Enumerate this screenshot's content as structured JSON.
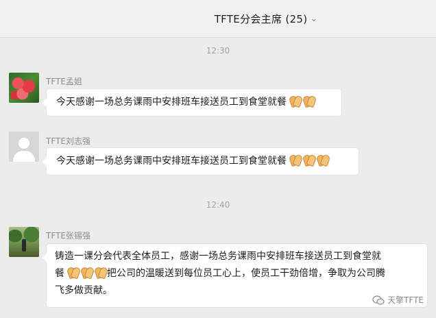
{
  "header": {
    "title": "TFTE分会主席 (25)",
    "chevron_icon": "chevron-down-icon"
  },
  "timestamps": [
    "12:30",
    "12:40"
  ],
  "messages": [
    {
      "sender": "TFTE孟姐",
      "avatar": "flower-photo",
      "text": "今天感谢一场总务课雨中安排班车接送员工到食堂就餐",
      "emoji": "clapping-hands",
      "emoji_count": 2
    },
    {
      "sender": "TFTE刘志强",
      "avatar": "default-avatar",
      "text": "今天感谢一场总务课雨中安排班车接送员工到食堂就餐",
      "emoji": "clapping-hands",
      "emoji_count": 3
    },
    {
      "sender": "TFTE张锡强",
      "avatar": "park-photo",
      "text_line1": "铸造一课分会代表全体员工，感谢一场总务课雨中安排班车接送员工到食堂就",
      "text_line2_a": "餐",
      "emoji": "clapping-hands",
      "emoji_count": 3,
      "text_line2_b": "把公司的温暖送到每位员工心上，使员工干劲倍增，争取为公司腾",
      "text_line3": "飞多做贡献。"
    }
  ],
  "watermark": {
    "text": "天擎TFTE",
    "icon": "wechat-icon"
  }
}
